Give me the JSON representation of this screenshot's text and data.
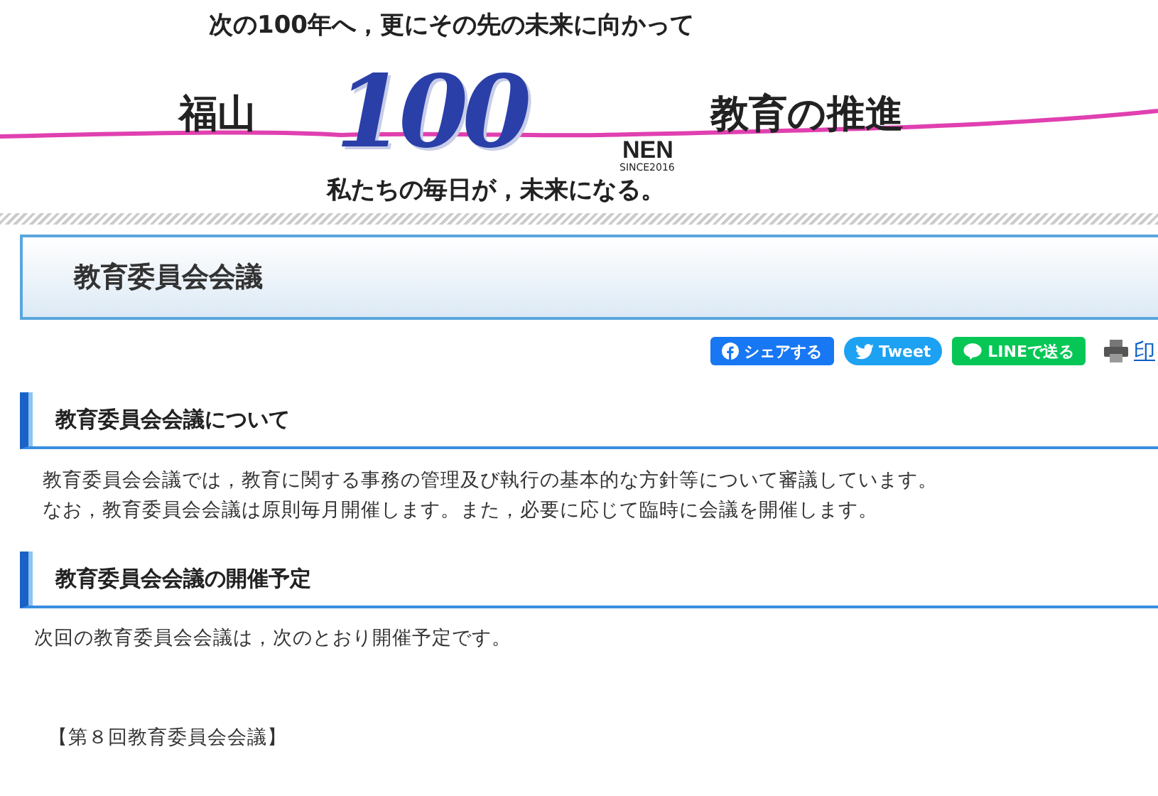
{
  "banner": {
    "tagline_top": "次の100年へ，更にその先の未来に向かって",
    "city": "福山",
    "logo_number": "100",
    "subtitle": "教育の推進",
    "logo_word": "NEN",
    "logo_since": "SINCE2016",
    "tagline_bottom": "私たちの毎日が，未来になる。"
  },
  "page_title": "教育委員会会議",
  "share_buttons": [
    {
      "kind": "facebook",
      "label": "シェアする"
    },
    {
      "kind": "twitter",
      "label": "Tweet"
    },
    {
      "kind": "line",
      "label": "LINEで送る"
    }
  ],
  "print_link": "印",
  "sections": [
    {
      "heading": "教育委員会会議について",
      "paragraphs": [
        "教育委員会会議では，教育に関する事務の管理及び執行の基本的な方針等について審議しています。",
        "なお，教育委員会会議は原則毎月開催します。また，必要に応じて臨時に会議を開催します。"
      ]
    },
    {
      "heading": "教育委員会会議の開催予定",
      "paragraphs": [
        "次回の教育委員会会議は，次のとおり開催予定です。"
      ]
    }
  ],
  "meeting_label": "【第８回教育委員会会議】"
}
